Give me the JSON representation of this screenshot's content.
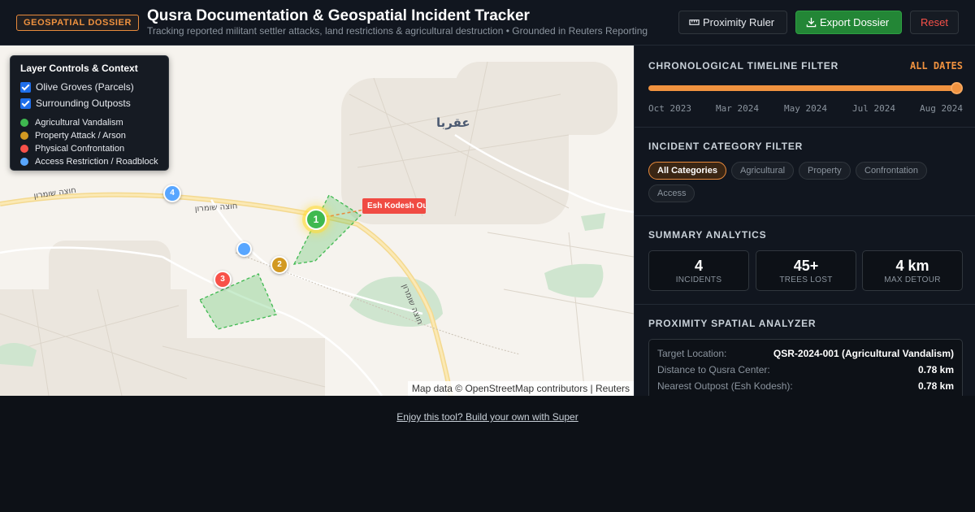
{
  "header": {
    "badge": "GEOSPATIAL DOSSIER",
    "title": "Qusra Documentation & Geospatial Incident Tracker",
    "subtitle": "Tracking reported militant settler attacks, land restrictions & agricultural destruction • Grounded in Reuters Reporting",
    "buttons": {
      "ruler": "Proximity Ruler",
      "export": "Export Dossier",
      "reset": "Reset"
    }
  },
  "map": {
    "layer_panel": {
      "title": "Layer Controls & Context",
      "checks": [
        {
          "label": "Olive Groves (Parcels)",
          "checked": true
        },
        {
          "label": "Surrounding Outposts",
          "checked": true
        }
      ],
      "legend": [
        {
          "label": "Agricultural Vandalism",
          "color": "#3fb950"
        },
        {
          "label": "Property Attack / Arson",
          "color": "#d29922"
        },
        {
          "label": "Physical Confrontation",
          "color": "#f85149"
        },
        {
          "label": "Access Restriction / Roadblock",
          "color": "#58a6ff"
        }
      ]
    },
    "town_label": "عقربا",
    "road_labels": [
      "חוצה שומרון",
      "חוצה שומרון",
      "חוצה שומרון"
    ],
    "markers": [
      "1",
      "2",
      "3",
      "4"
    ],
    "outpost_label": "Esh Kodesh Outpost",
    "attribution": "Map data © OpenStreetMap contributors | Reuters"
  },
  "timeline": {
    "title": "CHRONOLOGICAL TIMELINE FILTER",
    "status": "ALL DATES",
    "slider_fraction": 1.0,
    "ticks": [
      "Oct 2023",
      "Mar 2024",
      "May 2024",
      "Jul 2024",
      "Aug 2024"
    ]
  },
  "categories": {
    "title": "INCIDENT CATEGORY FILTER",
    "chips": [
      "All Categories",
      "Agricultural",
      "Property",
      "Confrontation",
      "Access"
    ],
    "active": "All Categories"
  },
  "summary": {
    "title": "SUMMARY ANALYTICS",
    "stats": [
      {
        "value": "4",
        "label": "INCIDENTS"
      },
      {
        "value": "45+",
        "label": "TREES LOST"
      },
      {
        "value": "4 km",
        "label": "MAX DETOUR"
      }
    ]
  },
  "proximity": {
    "title": "PROXIMITY SPATIAL ANALYZER",
    "rows": [
      {
        "key": "Target Location:",
        "value": "QSR-2024-001 (Agricultural Vandalism)"
      },
      {
        "key": "Distance to Qusra Center:",
        "value": "0.78 km"
      },
      {
        "key": "Nearest Outpost (Esh Kodesh):",
        "value": "0.78 km"
      }
    ]
  },
  "footer": {
    "link": "Enjoy this tool? Build your own with Super"
  },
  "colors": {
    "accent": "#f0923f",
    "export_green": "#238636",
    "reset_red": "#f85149"
  }
}
